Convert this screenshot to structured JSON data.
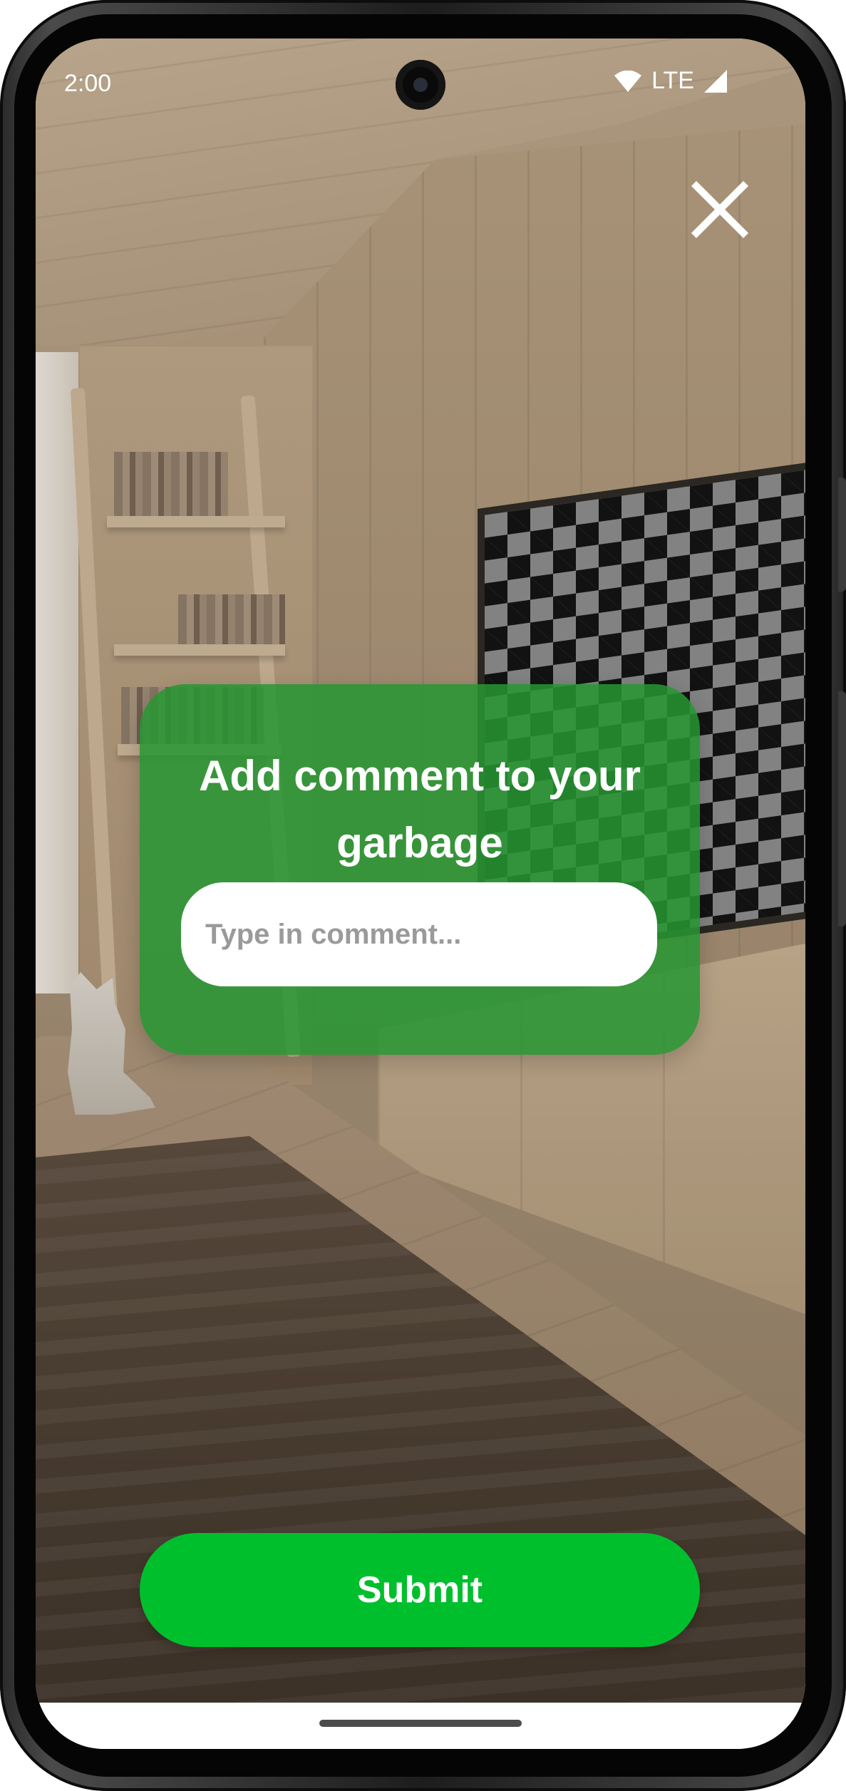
{
  "status_bar": {
    "time": "2:00",
    "network": "LTE",
    "icons": [
      "wifi-icon",
      "signal-icon"
    ]
  },
  "close": {
    "icon": "close-icon"
  },
  "dialog": {
    "title": "Add comment to your garbage",
    "comment_input": {
      "placeholder": "Type in comment...",
      "value": ""
    }
  },
  "submit": {
    "label": "Submit"
  },
  "colors": {
    "card": "#269632",
    "submit": "#00bf2d",
    "input_bg": "#ffffff",
    "placeholder": "#9a9a9a"
  }
}
